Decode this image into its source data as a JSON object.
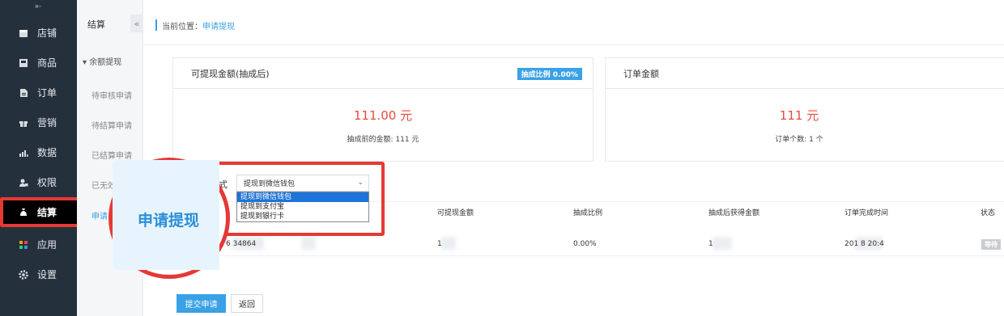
{
  "sidebar": {
    "top_icon": "⇤",
    "items": [
      {
        "label": "店铺",
        "icon": "store-icon"
      },
      {
        "label": "商品",
        "icon": "goods-icon"
      },
      {
        "label": "订单",
        "icon": "order-icon"
      },
      {
        "label": "营销",
        "icon": "gift-icon"
      },
      {
        "label": "数据",
        "icon": "chart-icon"
      },
      {
        "label": "权限",
        "icon": "user-lock-icon"
      },
      {
        "label": "结算",
        "icon": "money-bag-icon"
      },
      {
        "label": "应用",
        "icon": "apps-icon"
      },
      {
        "label": "设置",
        "icon": "gear-icon"
      }
    ],
    "active_index": 6
  },
  "subnav": {
    "title": "结算",
    "collapse": "«",
    "group": "▾ 余额提现",
    "items": [
      "待审核申请",
      "待结算申请",
      "已结算申请",
      "已无效申",
      "申请"
    ],
    "active_index": 4
  },
  "breadcrumb": {
    "prefix": "当前位置：",
    "current": "申请提现"
  },
  "card_withdrawable": {
    "title": "可提现金额(抽成后)",
    "badge": "抽成比例 0.00%",
    "amount": "111.00 元",
    "sub": "抽成前的金额: 111 元"
  },
  "card_orders": {
    "title": "订单金额",
    "amount": "111 元",
    "sub": "订单个数: 1 个"
  },
  "withdraw": {
    "label": "式",
    "selected": "提现到微信钱包",
    "options": [
      "提现到微信钱包",
      "提现到支付宝",
      "提现到银行卡"
    ]
  },
  "zoom": {
    "text": "申请提现"
  },
  "table": {
    "headers": [
      "可提现金额",
      "抽成比例",
      "抽成后获得金额",
      "订单完成时间",
      "状态"
    ],
    "row": {
      "order_no": "6        34864",
      "amount": "1",
      "rate": "0.00%",
      "net": "1",
      "time": "201        8 20:4",
      "status": "等待"
    }
  },
  "actions": {
    "submit": "提交申请",
    "back": "返回"
  },
  "colors": {
    "accent": "#3aa1e6",
    "highlight": "#e53935",
    "amount": "#e64b3c",
    "sidebar": "#25303d"
  }
}
